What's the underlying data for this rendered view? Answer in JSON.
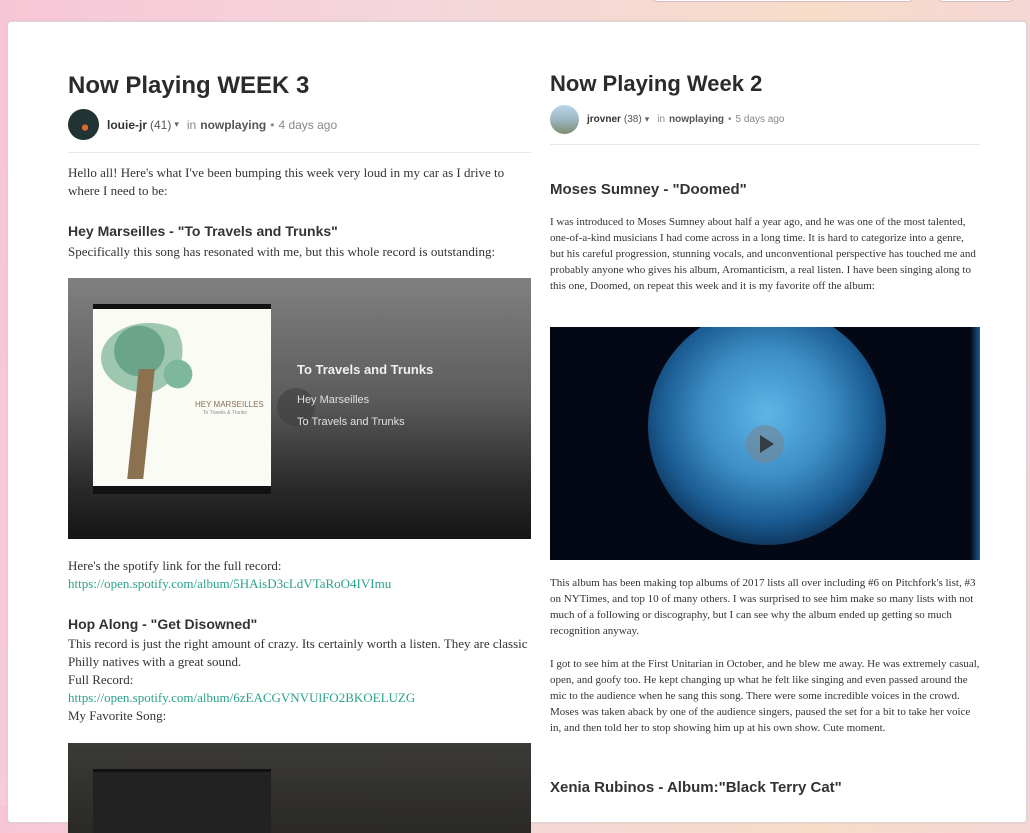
{
  "left_post": {
    "title": "Now Playing WEEK 3",
    "author": "louie-jr",
    "reputation": "(41)",
    "in_label": "in",
    "category": "nowplaying",
    "time": "4 days ago",
    "intro": "Hello all! Here's what I've been bumping this week very loud in my car as I drive to where I need to be:",
    "section1_title": "Hey Marseilles - \"To Travels and Trunks\"",
    "section1_text": "Specifically this song has resonated with me, but this whole record is outstanding:",
    "embed": {
      "cover_band": "HEY MARSEILLES",
      "cover_sub": "To Travels & Trunks",
      "title": "To Travels and Trunks",
      "artist": "Hey Marseilles",
      "album": "To Travels and Trunks"
    },
    "spotify_label": "Here's the spotify link for the full record:",
    "spotify_link1": "https://open.spotify.com/album/5HAisD3cLdVTaRoO4IVImu",
    "section2_title": "Hop Along - \"Get Disowned\"",
    "section2_text": "This record is just the right amount of crazy. Its certainly worth a listen. They are classic Philly natives with a great sound.",
    "full_record_label": "Full Record:",
    "spotify_link2": "https://open.spotify.com/album/6zEACGVNVUlFO2BKOELUZG",
    "fav_song_label": "My Favorite Song:"
  },
  "right_post": {
    "title": "Now Playing Week 2",
    "author": "jrovner",
    "reputation": "(38)",
    "in_label": "in",
    "category": "nowplaying",
    "time": "5 days ago",
    "section1_title": "Moses Sumney - \"Doomed\"",
    "para1": "I was introduced to Moses Sumney about half a year ago, and he was one of the most talented, one-of-a-kind musicians I had come across in a long time. It is hard to categorize into a genre, but his careful progression, stunning vocals, and unconventional perspective has touched me and probably anyone who gives his album, Aromanticism, a real listen. I have been singing along to this one, Doomed, on repeat this week and it is my favorite off the album:",
    "para2": "This album has been making top albums of 2017 lists all over including #6 on Pitchfork's list, #3 on NYTimes, and top 10 of many others. I was surprised to see him make so many lists with not much of a following or discography, but I can see why the album ended up getting so much recognition anyway.",
    "para3": "I got to see him at the First Unitarian in October, and he blew me away. He was extremely casual, open, and goofy too. He kept changing up what he felt like singing and even passed around the mic to the audience when he sang this song. There were some incredible voices in the crowd. Moses was taken aback by one of the audience singers, paused the set for a bit to take her voice in, and then told her to stop showing him up at his own show. Cute moment.",
    "section2_title": "Xenia Rubinos - Album:\"Black Terry Cat\""
  },
  "icons": {
    "caret": "▾",
    "dot": "•"
  }
}
